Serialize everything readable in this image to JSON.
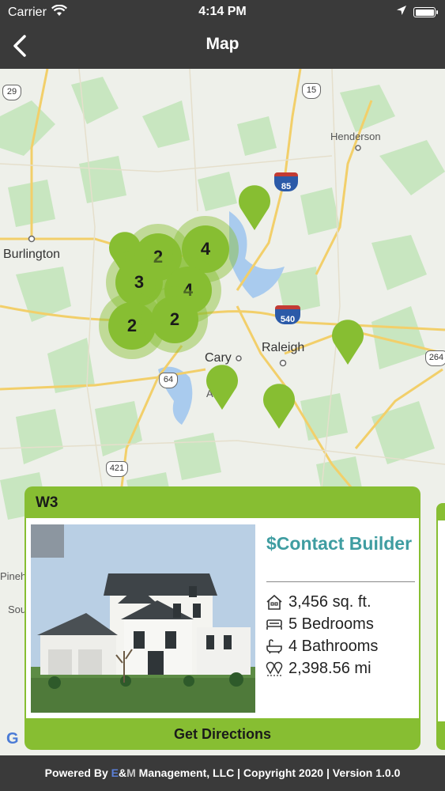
{
  "status": {
    "carrier": "Carrier",
    "time": "4:14 PM"
  },
  "nav": {
    "title": "Map"
  },
  "map": {
    "cities": {
      "burlington": "Burlington",
      "henderson": "Henderson",
      "raleigh": "Raleigh",
      "cary": "Cary",
      "pinehurst_partial": "Pineh",
      "southern_partial": "Sou",
      "apex_partial": "A"
    },
    "routes": {
      "us29": "29",
      "us15": "15",
      "i85": "85",
      "i540": "540",
      "us64": "64",
      "us421": "421",
      "us264": "264"
    },
    "clusters": [
      {
        "count": "2"
      },
      {
        "count": "4"
      },
      {
        "count": "3"
      },
      {
        "count": "4"
      },
      {
        "count": "2"
      },
      {
        "count": "2"
      }
    ]
  },
  "card": {
    "title": "W3",
    "price": "$Contact Builder",
    "sqft": "3,456 sq. ft.",
    "bedrooms": "5 Bedrooms",
    "bathrooms": "4 Bathrooms",
    "distance": "2,398.56 mi",
    "button": "Get Directions"
  },
  "footer": {
    "prefix": "Powered By ",
    "brand_e": "E",
    "brand_amp": "&",
    "brand_m": "M",
    "suffix": " Management, LLC | Copyright 2020 | Version 1.0.0"
  },
  "colors": {
    "accent_green": "#87be32",
    "price_teal": "#3f9da1",
    "bar_dark": "#3a3a3a"
  },
  "icons": [
    "wifi-icon",
    "location-arrow-icon",
    "battery-icon",
    "back-chevron-icon",
    "map-pin-icon",
    "house-icon",
    "bed-icon",
    "bathtub-icon",
    "route-pins-icon"
  ]
}
